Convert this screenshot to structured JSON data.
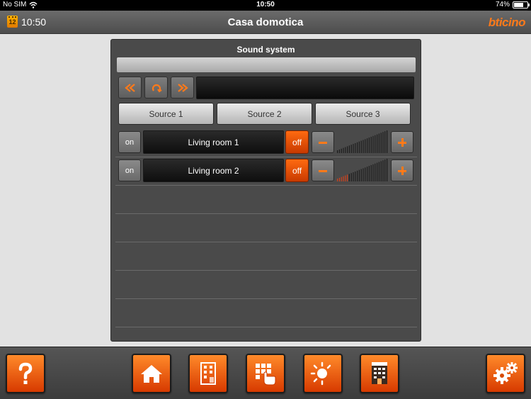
{
  "status_bar": {
    "carrier": "No SIM",
    "time": "10:50",
    "battery": "74%",
    "battery_level": 0.74
  },
  "header": {
    "clock_day": "12",
    "clock": "10:50",
    "title": "Casa domotica",
    "brand": "bticino"
  },
  "panel": {
    "title": "Sound system",
    "info_text": "",
    "display_text": "",
    "sources": [
      "Source 1",
      "Source 2",
      "Source 3"
    ],
    "zones": [
      {
        "on_label": "on",
        "name": "Living room 1",
        "off_label": "off",
        "volume_level": 0.0
      },
      {
        "on_label": "on",
        "name": "Living room 2",
        "off_label": "off",
        "volume_level": 0.2
      }
    ]
  },
  "icons": {
    "controls": [
      "rewind-icon",
      "repeat-icon",
      "fast-forward-icon"
    ],
    "bottom": [
      "help-icon",
      "home-icon",
      "room-icon",
      "keypad-touch-icon",
      "scenario-sun-icon",
      "building-icon",
      "settings-icon"
    ]
  },
  "colors": {
    "accent": "#ff6a10",
    "panel": "#4a4a4a",
    "header": "#5a5a5a",
    "background": "#e2e2e2"
  }
}
